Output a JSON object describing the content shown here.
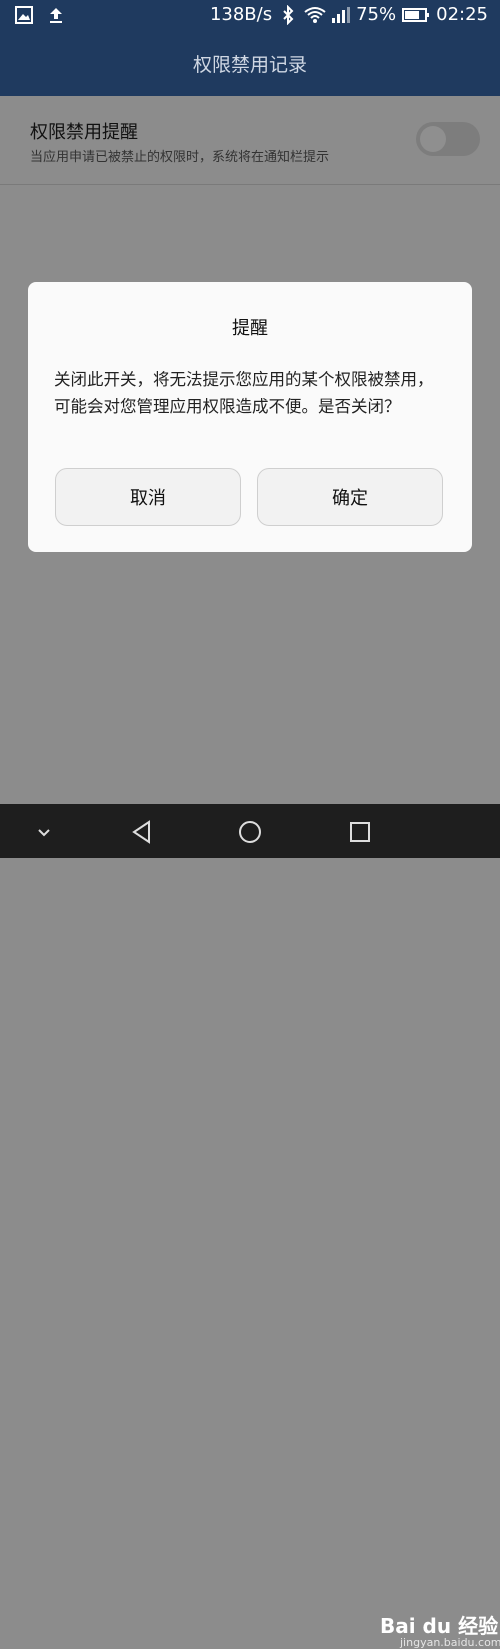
{
  "status_bar": {
    "speed": "138B/s",
    "battery": "75%",
    "time": "02:25"
  },
  "header": {
    "title": "权限禁用记录"
  },
  "setting": {
    "title": "权限禁用提醒",
    "description": "当应用申请已被禁止的权限时，系统将在通知栏提示",
    "toggle_on": false
  },
  "dialog": {
    "title": "提醒",
    "message": "关闭此开关，将无法提示您应用的某个权限被禁用，可能会对您管理应用权限造成不便。是否关闭？",
    "cancel_label": "取消",
    "confirm_label": "确定"
  },
  "watermark": {
    "brand": "Bai du 经验",
    "site": "jingyan.baidu.com"
  },
  "colors": {
    "header_bg": "#1f3a5f",
    "scrim": "#8c8c8c",
    "dialog_bg": "#fafafa",
    "navbar_bg": "#1e1e1e"
  }
}
